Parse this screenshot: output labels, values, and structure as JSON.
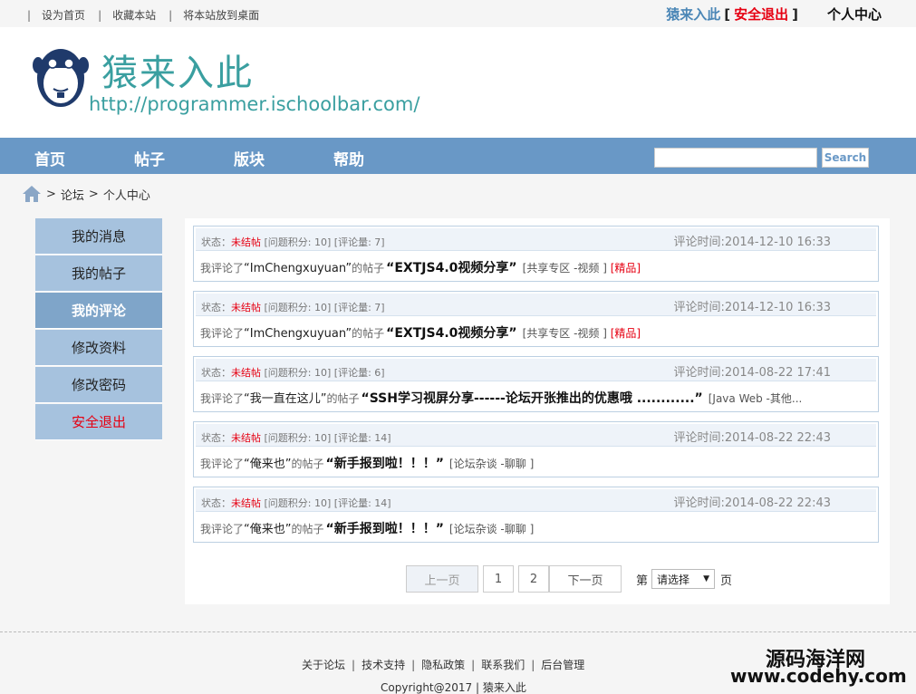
{
  "topbar": {
    "links": [
      "设为首页",
      "收藏本站",
      "将本站放到桌面"
    ],
    "site_name": "猿来入此",
    "bracket_open": "[",
    "logout": "安全退出",
    "bracket_close": "]",
    "user_center": "个人中心"
  },
  "header": {
    "brand_name": "猿来入此",
    "brand_url": "http://programmer.ischoolbar.com/"
  },
  "nav": {
    "items": [
      "首页",
      "帖子",
      "版块",
      "帮助"
    ],
    "search_placeholder": "",
    "search_label": "Search"
  },
  "breadcrumb": {
    "sep": ">",
    "forum": "论坛",
    "current": "个人中心"
  },
  "sidebar": {
    "items": [
      "我的消息",
      "我的帖子",
      "我的评论",
      "修改资料",
      "修改密码",
      "安全退出"
    ],
    "active_index": 2
  },
  "comments": [
    {
      "status_label": "状态：",
      "status": "未结帖",
      "meta": "[问题积分: 10] [评论量: 7]",
      "time": "评论时间:2014-12-10 16:33",
      "prefix": "我评论了",
      "user": "“ImChengxuyuan”",
      "mid": "的帖子",
      "title": "“EXTJS4.0视频分享”",
      "tag": "[共享专区 -视频 ]",
      "extra": "[精品]"
    },
    {
      "status_label": "状态：",
      "status": "未结帖",
      "meta": "[问题积分: 10] [评论量: 7]",
      "time": "评论时间:2014-12-10 16:33",
      "prefix": "我评论了",
      "user": "“ImChengxuyuan”",
      "mid": "的帖子",
      "title": "“EXTJS4.0视频分享”",
      "tag": "[共享专区 -视频 ]",
      "extra": "[精品]"
    },
    {
      "status_label": "状态：",
      "status": "未结帖",
      "meta": "[问题积分: 10] [评论量: 6]",
      "time": "评论时间:2014-08-22 17:41",
      "prefix": "我评论了",
      "user": "“我一直在这儿”",
      "mid": "的帖子",
      "title": "“SSH学习视屏分享------论坛开张推出的优惠哦 ............”",
      "tag": "[Java Web -其他...",
      "extra": ""
    },
    {
      "status_label": "状态：",
      "status": "未结帖",
      "meta": "[问题积分: 10] [评论量: 14]",
      "time": "评论时间:2014-08-22 22:43",
      "prefix": "我评论了",
      "user": "“俺来也”",
      "mid": "的帖子",
      "title": "“新手报到啦！！！”",
      "tag": "[论坛杂谈 -聊聊 ]",
      "extra": ""
    },
    {
      "status_label": "状态：",
      "status": "未结帖",
      "meta": "[问题积分: 10] [评论量: 14]",
      "time": "评论时间:2014-08-22 22:43",
      "prefix": "我评论了",
      "user": "“俺来也”",
      "mid": "的帖子",
      "title": "“新手报到啦！！！”",
      "tag": "[论坛杂谈 -聊聊 ]",
      "extra": ""
    }
  ],
  "pager": {
    "prev": "上一页",
    "pages": [
      "1",
      "2"
    ],
    "next": "下一页",
    "goto_label": "第",
    "select_value": "请选择",
    "suffix": "页"
  },
  "footer": {
    "links": [
      "关于论坛",
      "技术支持",
      "隐私政策",
      "联系我们",
      "后台管理"
    ],
    "copyright": "Copyright@2017 | 猿来入此"
  },
  "watermark": {
    "line1": "源码海洋网",
    "line2": "www.codehy.com"
  },
  "colors": {
    "nav_bg": "#6998c6",
    "brand": "#3a9fa0",
    "danger": "#e60012",
    "sidebar": "#a6c2de",
    "sidebar_active": "#7fa5c9"
  }
}
